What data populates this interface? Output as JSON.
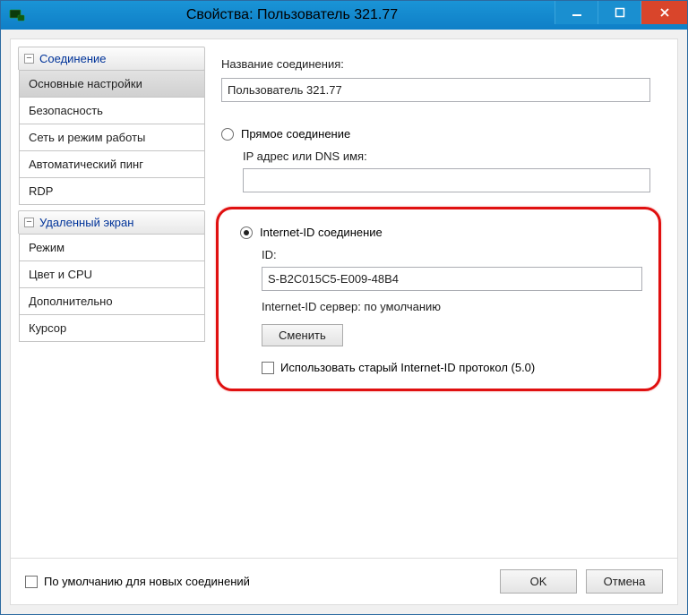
{
  "window": {
    "title": "Свойства: Пользователь 321.77"
  },
  "sidebar": {
    "groups": [
      {
        "label": "Соединение",
        "items": [
          "Основные настройки",
          "Безопасность",
          "Сеть и режим работы",
          "Автоматический пинг",
          "RDP"
        ]
      },
      {
        "label": "Удаленный экран",
        "items": [
          "Режим",
          "Цвет и CPU",
          "Дополнительно",
          "Курсор"
        ]
      }
    ]
  },
  "main": {
    "connection_name_label": "Название соединения:",
    "connection_name_value": "Пользователь 321.77",
    "direct_radio_label": "Прямое соединение",
    "ip_dns_label": "IP адрес или DNS имя:",
    "ip_dns_value": "",
    "internet_id_radio_label": "Internet-ID соединение",
    "id_label": "ID:",
    "id_value": "S-B2C015C5-E009-48B4",
    "server_label": "Internet-ID сервер: по умолчанию",
    "change_button": "Сменить",
    "old_protocol_checkbox": "Использовать старый Internet-ID протокол (5.0)"
  },
  "footer": {
    "default_checkbox": "По умолчанию для новых соединений",
    "ok": "OK",
    "cancel": "Отмена"
  }
}
